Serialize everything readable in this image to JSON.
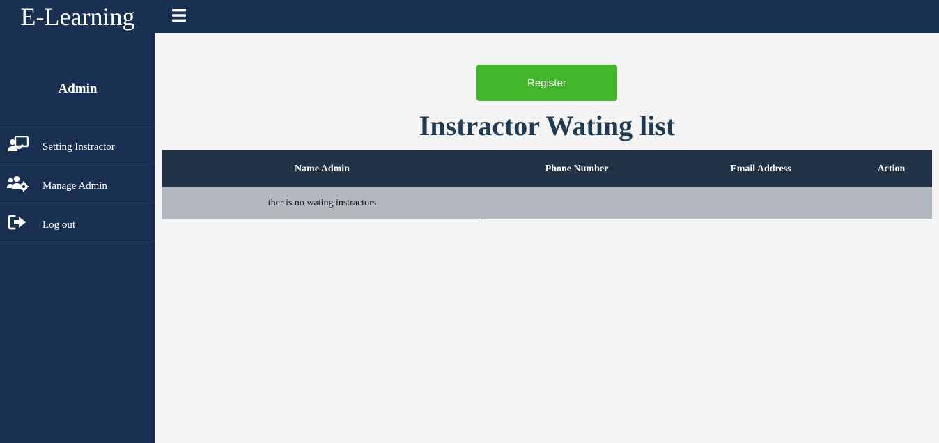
{
  "app": {
    "title": "E-Learning"
  },
  "sidebar": {
    "title": "Admin",
    "items": [
      {
        "label": "Setting Instractor",
        "icon": "chalkboard-teacher-icon"
      },
      {
        "label": "Manage Admin",
        "icon": "users-cog-icon"
      },
      {
        "label": "Log out",
        "icon": "sign-out-icon"
      }
    ]
  },
  "main": {
    "register_label": "Register",
    "title": "Instractor Wating list",
    "table": {
      "columns": [
        "Name Admin",
        "Phone Number",
        "Email Address",
        "Action"
      ],
      "empty_message": "ther is no wating instractors"
    }
  },
  "colors": {
    "nav": "#1a3052",
    "accent": "#42b72a",
    "table_header": "#223348",
    "table_row": "#b3b8bf",
    "title": "#1f3a52"
  }
}
